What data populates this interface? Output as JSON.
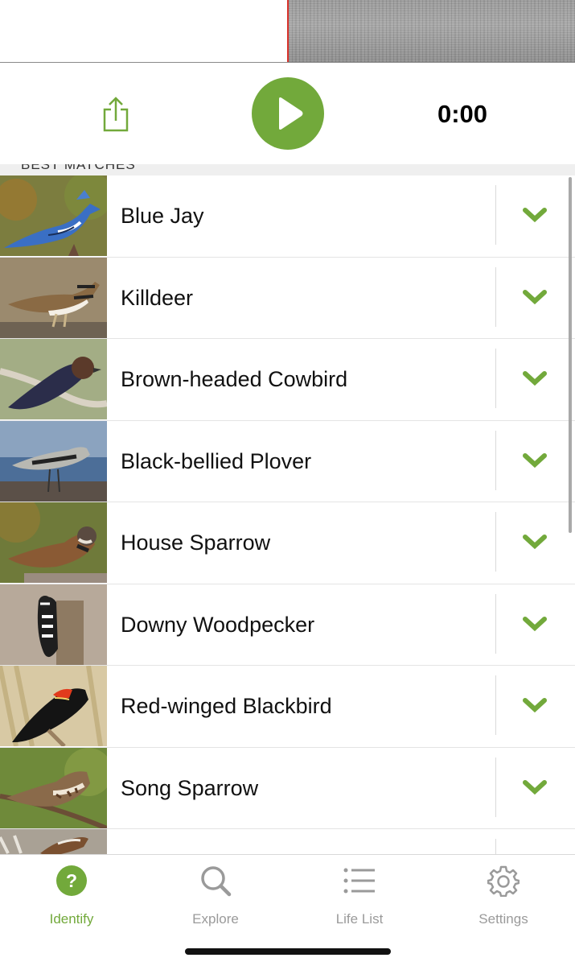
{
  "player": {
    "time": "0:00",
    "accent_color": "#72a93b",
    "cursor_color": "#d8322b",
    "icons": {
      "share": "share-icon",
      "play": "play-icon"
    }
  },
  "section": {
    "title": "BEST MATCHES"
  },
  "matches": [
    {
      "name": "Blue Jay"
    },
    {
      "name": "Killdeer"
    },
    {
      "name": "Brown-headed Cowbird"
    },
    {
      "name": "Black-bellied Plover"
    },
    {
      "name": "House Sparrow"
    },
    {
      "name": "Downy Woodpecker"
    },
    {
      "name": "Red-winged Blackbird"
    },
    {
      "name": "Song Sparrow"
    },
    {
      "name": ""
    }
  ],
  "tabbar": {
    "tabs": [
      {
        "label": "Identify",
        "icon": "question-circle-icon",
        "active": true
      },
      {
        "label": "Explore",
        "icon": "search-icon",
        "active": false
      },
      {
        "label": "Life List",
        "icon": "list-icon",
        "active": false
      },
      {
        "label": "Settings",
        "icon": "gear-icon",
        "active": false
      }
    ],
    "active_color": "#72a93b",
    "inactive_color": "#9a9a9a"
  }
}
